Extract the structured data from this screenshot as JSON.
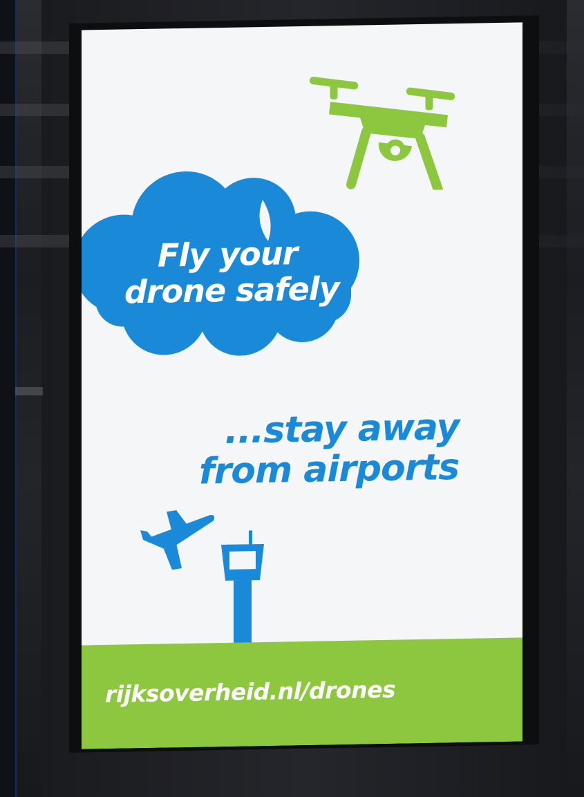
{
  "poster": {
    "headline_line1": "Fly your",
    "headline_line2": "drone safely",
    "tagline_line1": "...stay away",
    "tagline_line2": "from airports",
    "url": "rijksoverheid.nl/drones"
  },
  "icons": {
    "drone": "drone-icon",
    "cloud": "cloud-icon",
    "airplane": "airplane-icon",
    "control_tower": "control-tower-icon"
  },
  "colors": {
    "blue": "#1a8ad8",
    "green": "#8dc63f",
    "screen_bg": "#f4f6f8",
    "text_on_color": "#ffffff"
  }
}
